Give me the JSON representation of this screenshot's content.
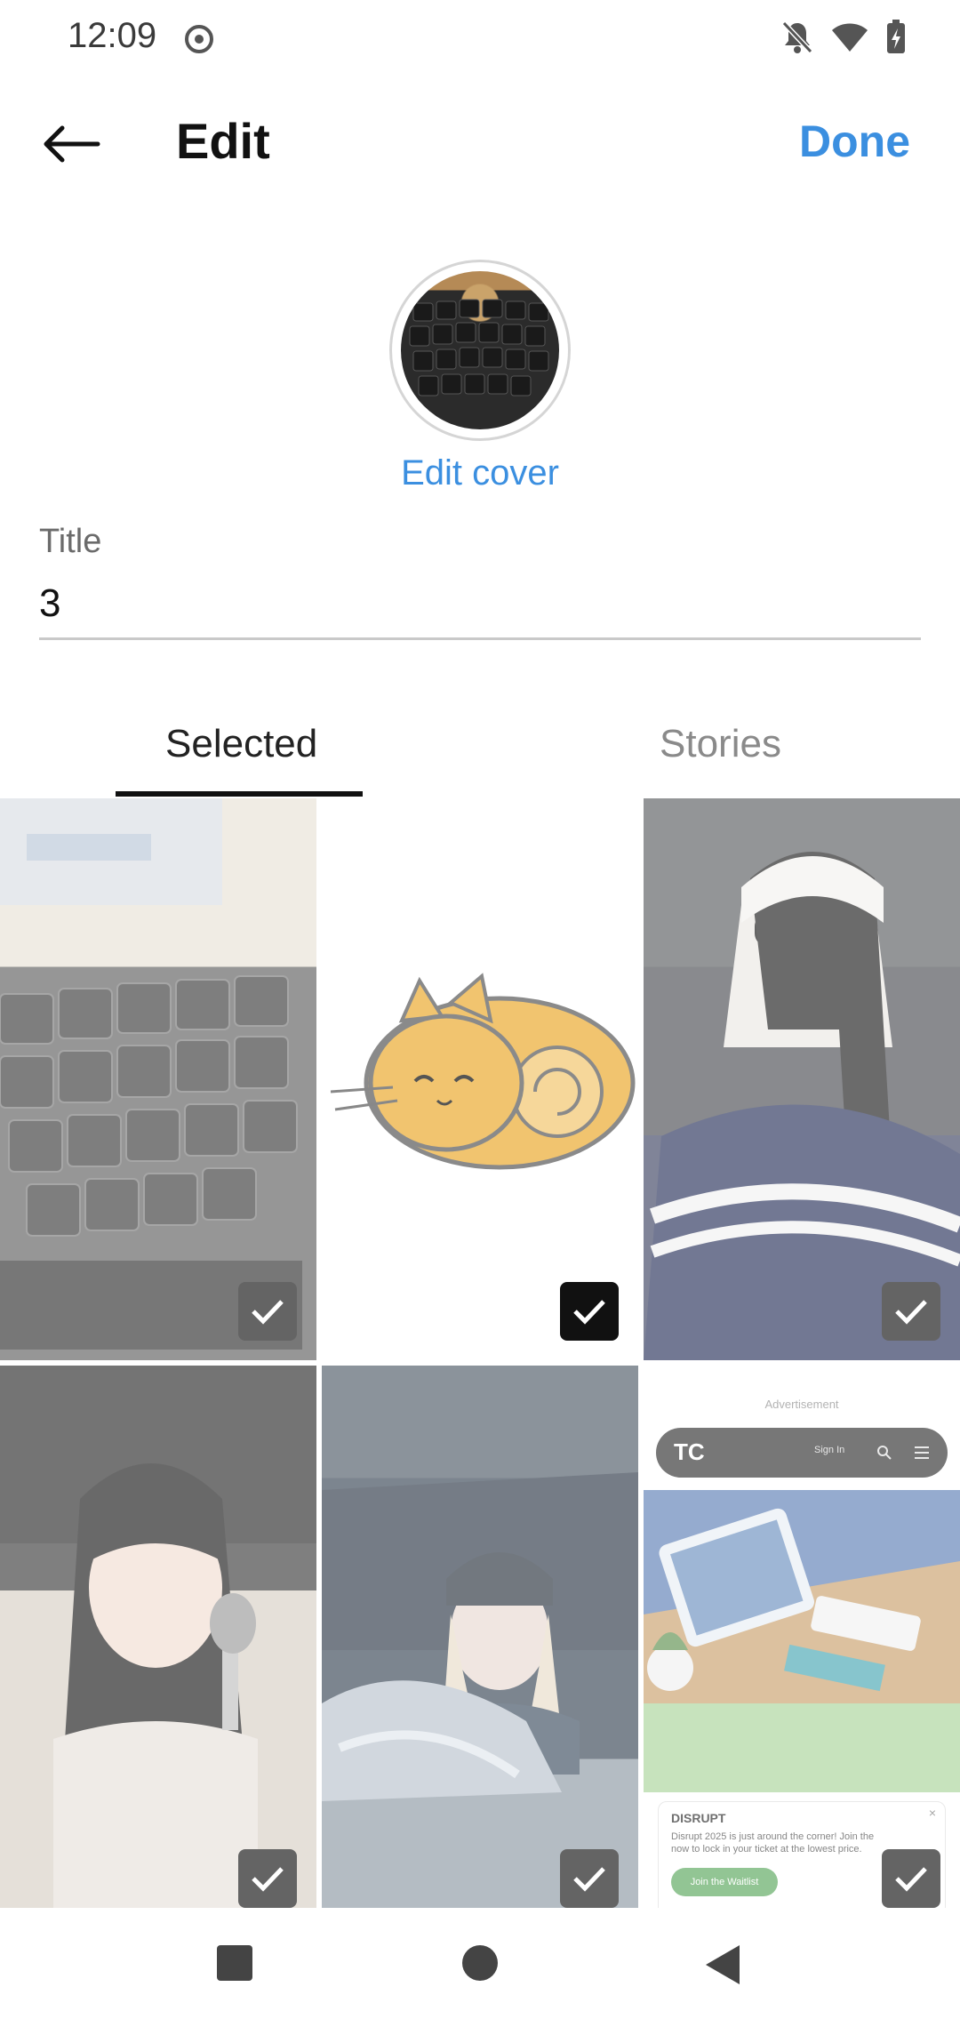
{
  "status_bar": {
    "time": "12:09",
    "icons": [
      "screen-record-icon",
      "bell-off-icon",
      "wifi-icon",
      "battery-charging-icon"
    ]
  },
  "header": {
    "title": "Edit",
    "done_label": "Done"
  },
  "cover": {
    "edit_label": "Edit cover"
  },
  "title_field": {
    "label": "Title",
    "value": "3"
  },
  "tabs": [
    {
      "label": "Selected",
      "active": true
    },
    {
      "label": "Stories",
      "active": false
    }
  ],
  "grid": {
    "items": [
      {
        "name": "keyboard photo",
        "selected": true
      },
      {
        "name": "cat sticker",
        "selected": true
      },
      {
        "name": "headscarf portrait",
        "selected": true
      },
      {
        "name": "selfie with brush",
        "selected": true
      },
      {
        "name": "car selfie",
        "selected": true
      },
      {
        "name": "article screenshot",
        "selected": true
      }
    ],
    "article": {
      "ad_label": "Advertisement",
      "brand": "TC",
      "sign_in": "Sign In",
      "promo_title": "DISRUPT",
      "promo_text": "Disrupt 2025 is just around the corner! Join the now to lock in your ticket at the lowest price.",
      "promo_button": "Join the Waitlist"
    }
  },
  "colors": {
    "accent": "#3b8fe0",
    "checkbox": "#111111"
  }
}
